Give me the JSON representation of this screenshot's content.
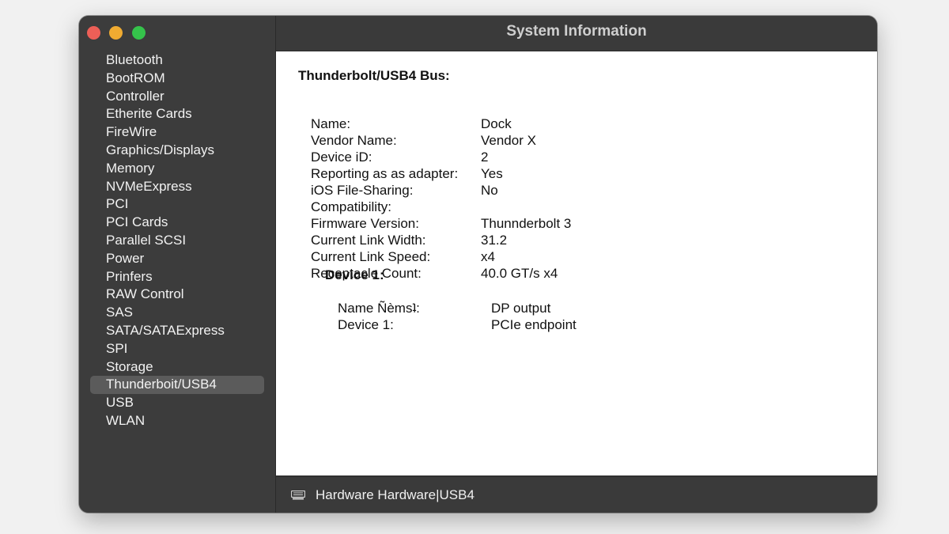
{
  "window": {
    "title": "System Information"
  },
  "sidebar": {
    "items": [
      {
        "label": "Bluetooth"
      },
      {
        "label": "BootROM"
      },
      {
        "label": "Controller"
      },
      {
        "label": "Etherite  Cards"
      },
      {
        "label": "FireWire"
      },
      {
        "label": "Graphics/Displays"
      },
      {
        "label": "Memory"
      },
      {
        "label": "NVMeExpress"
      },
      {
        "label": "PCI"
      },
      {
        "label": "PCI Cards"
      },
      {
        "label": "Parallel  SCSI"
      },
      {
        "label": "Power"
      },
      {
        "label": "Prinfers"
      },
      {
        "label": "RAW Control"
      },
      {
        "label": "SAS"
      },
      {
        "label": "SATA/SATAExpress"
      },
      {
        "label": "SPI"
      },
      {
        "label": "Storage"
      },
      {
        "label": "Thunderboit/USB4"
      },
      {
        "label": "USB"
      },
      {
        "label": "WLAN"
      }
    ],
    "selected_index": 18
  },
  "detail": {
    "section_title": "Thunderbolt/USB4 Bus:",
    "properties": [
      {
        "label": "Name:",
        "value": "Dock"
      },
      {
        "label": "Vendor Name:",
        "value": "Vendor X"
      },
      {
        "label": "Device iD:",
        "value": "2"
      },
      {
        "label": "Reporting as as adapter:",
        "value": "Yes"
      },
      {
        "label": "iOS File-Sharing:",
        "value": "No"
      },
      {
        "label": "Compatibility:",
        "value": ""
      },
      {
        "label": "Firmware Version:",
        "value": "Thunnderbolt 3"
      },
      {
        "label": "Current Link Width:",
        "value": "31.2"
      },
      {
        "label": "Current Link Speed:",
        "value": "x4"
      },
      {
        "label": "Receptacle Count:",
        "value": "40.0 GT/s x4"
      }
    ],
    "device": {
      "heading": "Device 1:",
      "properties": [
        {
          "label": "Name Ñèmsʇ:",
          "value": "DP output"
        },
        {
          "label": "Device 1:",
          "value": "PCIe  endpoint"
        }
      ]
    }
  },
  "statusbar": {
    "icon": "hardware-icon",
    "path": "Hardware Hardware|USB4"
  }
}
